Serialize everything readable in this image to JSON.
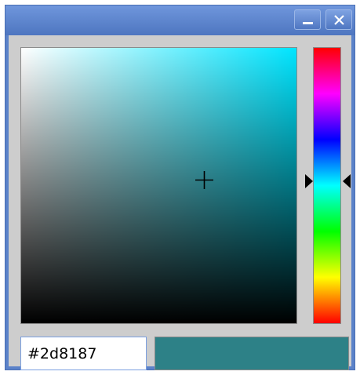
{
  "window": {
    "minimize_icon": "minimize-icon",
    "close_icon": "close-icon",
    "titlebar_color": "#5b82c9"
  },
  "picker": {
    "hue_color": "#00e5ff",
    "hue_gradient_stops": [
      "#ff0000",
      "#ff00ff",
      "#0000ff",
      "#00ffff",
      "#00ff00",
      "#ffff00",
      "#ff0000"
    ],
    "hex_value": "#2d8187",
    "preview_color": "#2d8187",
    "crosshair_icon": "crosshair-icon",
    "hue_arrow_icon": "triangle-icon"
  }
}
